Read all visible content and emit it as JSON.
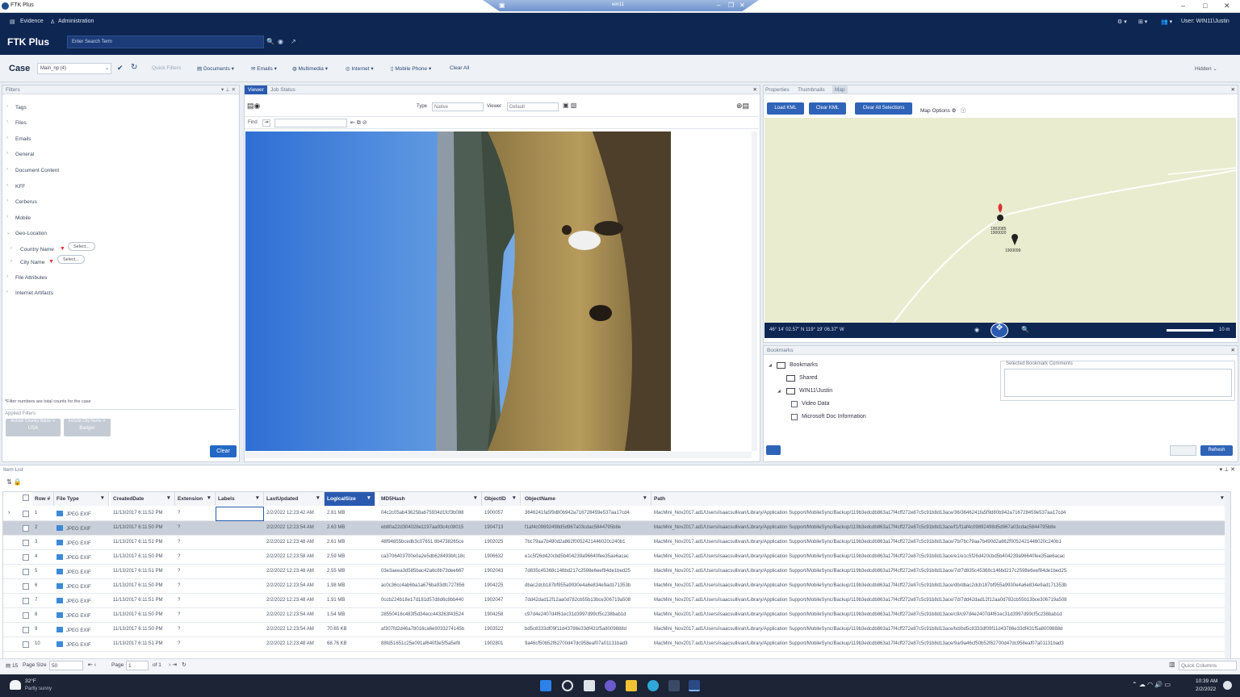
{
  "window": {
    "title": "FTK Plus",
    "vm_title": "win11"
  },
  "nav": {
    "evidence": "Evidence",
    "administration": "Administration",
    "user": "User: WIN11\\Justin"
  },
  "header": {
    "brand": "FTK Plus",
    "search_placeholder": "Enter Search Term"
  },
  "case": {
    "label": "Case",
    "selected": "Main_np (4)",
    "menu": [
      {
        "label": "Quick Filters",
        "dim": true
      },
      {
        "label": "Documents"
      },
      {
        "label": "Emails"
      },
      {
        "label": "Multimedia"
      },
      {
        "label": "Internet"
      },
      {
        "label": "Mobile Phone"
      },
      {
        "label": "Clear All"
      }
    ],
    "hidden_label": "Hidden"
  },
  "filters": {
    "title": "Filters",
    "items": [
      "Tags",
      "Files",
      "Emails",
      "General",
      "Document Content",
      "KFF",
      "Cerberus",
      "Mobile",
      "Geo-Location",
      "Country Name",
      "City Name",
      "File Attributes",
      "Internet Artifacts"
    ],
    "select_label": "Select...",
    "note": "*Filter numbers are total counts for the case",
    "applied_title": "Applied Filters",
    "applied": [
      {
        "label": "Include Country Name",
        "value": "USA"
      },
      {
        "label": "Include City Name",
        "value": "Badger"
      }
    ],
    "clear_label": "Clear"
  },
  "viewer": {
    "tabs": [
      "Viewer",
      "Job Status"
    ],
    "type_label": "Type",
    "type_value": "Native",
    "viewer_label": "Viewer",
    "viewer_value": "Default",
    "find_label": "Find"
  },
  "map": {
    "tabs": [
      "Properties",
      "Thumbnails",
      "Map"
    ],
    "load_kml": "Load KML",
    "clear_kml": "Clear KML",
    "clear_all": "Clear All Selections",
    "map_options": "Map Options",
    "coords": "46° 14' 02.57\" N 119° 19' 06.37\" W",
    "scale": "10 m",
    "marker_labels": [
      "1902085\n1900020",
      "1900099"
    ]
  },
  "bookmarks": {
    "title": "Bookmarks",
    "tree": [
      {
        "label": "Bookmarks",
        "level": 0,
        "kind": "folder"
      },
      {
        "label": "Shared",
        "level": 1,
        "kind": "folder"
      },
      {
        "label": "WIN11\\Justin",
        "level": 1,
        "kind": "folder"
      },
      {
        "label": "Video Data",
        "level": 2,
        "kind": "check"
      },
      {
        "label": "Microsoft Doc Information",
        "level": 2,
        "kind": "check"
      }
    ],
    "comments_title": "Selected Bookmark Comments",
    "refresh": "Refresh"
  },
  "itemlist": {
    "title": "Item List",
    "columns": [
      "Row #",
      "File Type",
      "CreatedDate",
      "Extension",
      "Labels",
      "LastUpdated",
      "LogicalSize",
      "MD5Hash",
      "ObjectID",
      "ObjectName",
      "Path"
    ],
    "rows": [
      [
        "1",
        "JPEG EXIF",
        "11/13/2017 6:11:52 PM",
        "?",
        "",
        "2/2/2022 12:23:42 AM",
        "2.81 MB",
        "04c2c05ab436258ab75934d1fcf3b088",
        "1900057",
        "3646241fa5f9d80b942a716728459e537aa17cd4",
        "MacMini_Nov2017.ad1/Users/isaacsullivan/Library/Application Support/MobileSync/Backup/119b3edcdb863a17f4cff272e87c5c91b8d13ace/36/3646241fa5f9d80b942a716728459e537aa17cd4"
      ],
      [
        "2",
        "JPEG EXIF",
        "11/13/2017 6:11:50 PM",
        "?",
        "",
        "2/2/2022 12:23:54 AM",
        "2.63 MB",
        "eb80a22d304028e1197aa93c4c08015",
        "1904713",
        "f1af4c09892498d5d967a03cdac5844795b8e",
        "MacMini_Nov2017.ad1/Users/isaacsullivan/Library/Application Support/MobileSync/Backup/119b3edcdb863a17f4cff272e87c5c91b8d13ace/f1/f1af4c09892498d5d967a03cdac5844795b8e"
      ],
      [
        "3",
        "JPEG EXIF",
        "11/13/2017 6:11:51 PM",
        "?",
        "",
        "2/2/2022 12:23:48 AM",
        "2.61 MB",
        "48f94855bcedb3c07651 8b4738265ce",
        "1902025",
        "7bc79aa7b490d2a862f0052421446020c240b1",
        "MacMini_Nov2017.ad1/Users/isaacsullivan/Library/Application Support/MobileSync/Backup/119b3edcdb863a17f4cff272e87c5c91b8d13ace/7b/7bc79aa7b490d2a862f0052421446020c240b1"
      ],
      [
        "4",
        "JPEG EXIF",
        "11/13/2017 6:11:50 PM",
        "?",
        "",
        "2/2/2022 12:23:58 AM",
        "2.59 MB",
        "ca3706403700e0a2e5db628493bfc18c",
        "1906632",
        "e1c5f26d420cbd5b404239a96640fee35ae6acac",
        "MacMini_Nov2017.ad1/Users/isaacsullivan/Library/Application Support/MobileSync/Backup/119b3edcdb863a17f4cff272e87c5c91b8d13ace/e1/e1c5f26d420cbd5b404239a96640fee35ae6acac"
      ],
      [
        "5",
        "JPEG EXIF",
        "11/13/2017 6:11:51 PM",
        "?",
        "",
        "2/2/2022 12:23:48 AM",
        "2.55 MB",
        "03e3aeea3d585bac42a6c8b73dee667",
        "1902043",
        "7d835c45368c146bd217c2598e6eef84de1bed25",
        "MacMini_Nov2017.ad1/Users/isaacsullivan/Library/Application Support/MobileSync/Backup/119b3edcdb863a17f4cff272e87c5c91b8d13ace/7d/7d835c45368c146bd217c2598e6eef84de1bed25"
      ],
      [
        "6",
        "JPEG EXIF",
        "11/13/2017 6:11:50 PM",
        "?",
        "",
        "2/2/2022 12:23:54 AM",
        "1.98 MB",
        "ac0c36cc4ab6ba1a676ba93dfc727856",
        "1904225",
        "dbac2dcb187bf955a9930e4a6e834e9ad171353b",
        "MacMini_Nov2017.ad1/Users/isaacsullivan/Library/Application Support/MobileSync/Backup/119b3edcdb863a17f4cff272e87c5c91b8d13ace/db/dbac2dcb187bf955a9930e4a6e834e9ad171353b"
      ],
      [
        "7",
        "JPEG EXIF",
        "11/13/2017 6:11:51 PM",
        "?",
        "",
        "2/2/2022 12:23:48 AM",
        "1.91 MB",
        "0ccb224b18e17d181d57d8d6c8bb440",
        "1902047",
        "7dd42dad12f12aa0d782cb55b13bce306719a508",
        "MacMini_Nov2017.ad1/Users/isaacsullivan/Library/Application Support/MobileSync/Backup/119b3edcdb863a17f4cff272e87c5c91b8d13ace/7d/7dd42dad12f12aa0d782cb55b13bce306719a508"
      ],
      [
        "8",
        "JPEG EXIF",
        "11/13/2017 6:11:50 PM",
        "?",
        "",
        "2/2/2022 12:23:54 AM",
        "1.54 MB",
        "28550416c483f5d34ecc443263f43524",
        "1904258",
        "c97d4e2407d4f61ec31d3997d99cf5c238bab1d",
        "MacMini_Nov2017.ad1/Users/isaacsullivan/Library/Application Support/MobileSync/Backup/119b3edcdb863a17f4cff272e87c5c91b8d13ace/c9/c97d4e2407d4f61ec31d3997d99cf5c238bab1d"
      ],
      [
        "9",
        "JPEG EXIF",
        "11/13/2017 6:11:50 PM",
        "?",
        "",
        "2/2/2022 12:23:54 AM",
        "70.65 KB",
        "af307fd2d46a78016ca6e9033274145b",
        "1903522",
        "bd5c8333df09f11d43786e33df431f5a8009888d",
        "MacMini_Nov2017.ad1/Users/isaacsullivan/Library/Application Support/MobileSync/Backup/119b3edcdb863a17f4cff272e87c5c91b8d13ace/bd/bd5c8333df09f11d43786e33df431f5a8009888d"
      ],
      [
        "10",
        "JPEG EXIF",
        "11/13/2017 6:11:51 PM",
        "?",
        "",
        "2/2/2022 12:23:48 AM",
        "68.76 KB",
        "88fd51651c25e091af640f3e5f5a5ef8",
        "1902801",
        "9a46cf50b52f62700d47dc958eaf07a01131bad3",
        "MacMini_Nov2017.ad1/Users/isaacsullivan/Library/Application Support/MobileSync/Backup/119b3edcdb863a17f4cff272e87c5c91b8d13ace/9a/9a46cf50b52f62700d47dc958eaf07a01131bad3"
      ]
    ]
  },
  "pager": {
    "count": "15",
    "page_size_label": "Page Size",
    "page_size": "50",
    "page_label": "Page",
    "page": "1",
    "of": "of 1",
    "quick_columns": "Quick Columns"
  },
  "taskbar": {
    "temp": "32°F",
    "weather": "Partly sunny",
    "time": "10:39 AM",
    "date": "2/2/2022"
  },
  "colors": {
    "navy": "#0d2652",
    "accent": "#2a5ab0",
    "button": "#2468c4"
  }
}
